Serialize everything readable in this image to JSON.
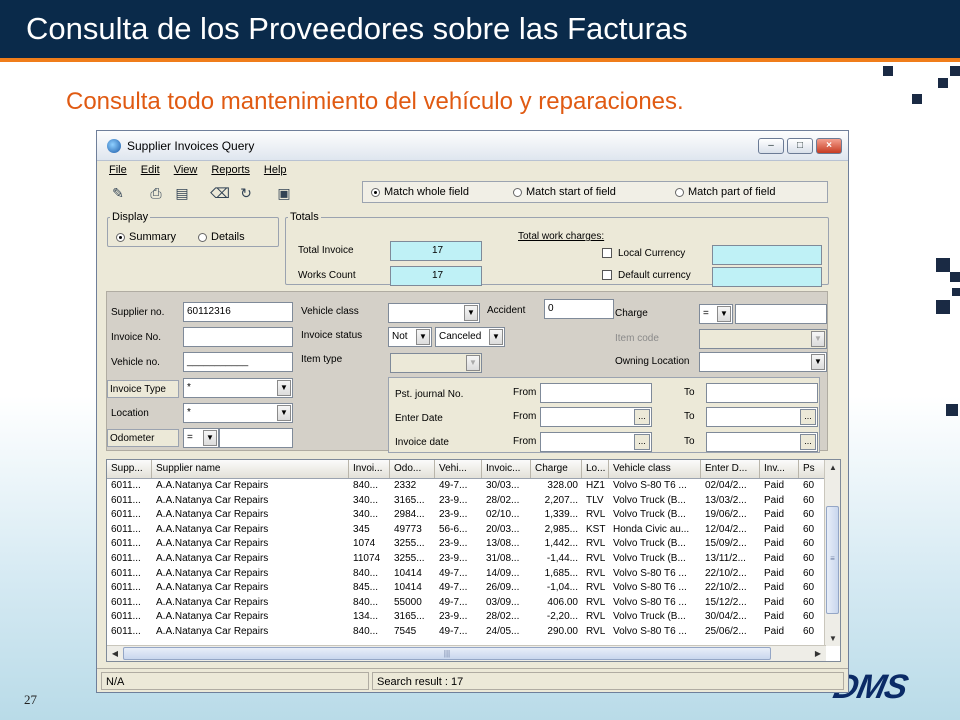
{
  "slide": {
    "title": "Consulta de los Proveedores sobre las Facturas",
    "subtitle": "Consulta todo mantenimiento del vehículo y reparaciones.",
    "page_number": "27",
    "brand": "DMS"
  },
  "window": {
    "title": "Supplier Invoices Query",
    "minimize": "–",
    "maximize": "□",
    "close": "×"
  },
  "menu": [
    "File",
    "Edit",
    "View",
    "Reports",
    "Help"
  ],
  "match": {
    "whole": "Match whole field",
    "start": "Match start of field",
    "part": "Match part of field",
    "selected": "whole"
  },
  "display": {
    "legend": "Display",
    "summary": "Summary",
    "details": "Details",
    "selected": "summary"
  },
  "totals": {
    "legend": "Totals",
    "total_invoice_label": "Total Invoice",
    "total_invoice": "17",
    "works_count_label": "Works Count",
    "works_count": "17",
    "work_charges_label": "Total work charges:",
    "local_currency": "Local Currency",
    "default_currency": "Default currency"
  },
  "filters": {
    "supplier_no_label": "Supplier no.",
    "supplier_no": "60112316",
    "invoice_no_label": "Invoice No.",
    "vehicle_no_label": "Vehicle no.",
    "vehicle_no": "___________",
    "invoice_type_label": "Invoice Type",
    "invoice_type": "*",
    "location_label": "Location",
    "location": "*",
    "odometer_label": "Odometer",
    "odometer_op": "=",
    "vehicle_class_label": "Vehicle class",
    "invoice_status_label": "Invoice status",
    "invoice_status_op": "Not",
    "invoice_status_value": "Canceled",
    "item_type_label": "Item type",
    "accident_label": "Accident",
    "accident": "0",
    "charge_label": "Charge",
    "charge_op": "=",
    "item_code_label": "Item code",
    "owning_location_label": "Owning Location",
    "pst_journal_label": "Pst. journal No.",
    "enter_date_label": "Enter Date",
    "invoice_date_label": "Invoice date",
    "from_label": "From",
    "to_label": "To",
    "ellipsis": "..."
  },
  "grid": {
    "columns": [
      "Supp...",
      "Supplier name",
      "Invoi...",
      "Odo...",
      "Vehi...",
      "Invoic...",
      "Charge",
      "Lo...",
      "Vehicle class",
      "Enter D...",
      "Inv...",
      "Ps"
    ],
    "rows": [
      [
        "6011...",
        "A.A.Natanya  Car Repairs",
        "840...",
        "2332",
        "49-7...",
        "30/03...",
        "328.00",
        "HZ1",
        "Volvo S-80 T6 ...",
        "02/04/2...",
        "Paid",
        "60"
      ],
      [
        "6011...",
        "A.A.Natanya  Car Repairs",
        "340...",
        "3165...",
        "23-9...",
        "28/02...",
        "2,207...",
        "TLV",
        "Volvo Truck (B...",
        "13/03/2...",
        "Paid",
        "60"
      ],
      [
        "6011...",
        "A.A.Natanya  Car Repairs",
        "340...",
        "2984...",
        "23-9...",
        "02/10...",
        "1,339...",
        "RVL",
        "Volvo Truck (B...",
        "19/06/2...",
        "Paid",
        "60"
      ],
      [
        "6011...",
        "A.A.Natanya  Car Repairs",
        "345",
        "49773",
        "56-6...",
        "20/03...",
        "2,985...",
        "KST",
        "Honda Civic au...",
        "12/04/2...",
        "Paid",
        "60"
      ],
      [
        "6011...",
        "A.A.Natanya  Car Repairs",
        "1074",
        "3255...",
        "23-9...",
        "13/08...",
        "1,442...",
        "RVL",
        "Volvo Truck (B...",
        "15/09/2...",
        "Paid",
        "60"
      ],
      [
        "6011...",
        "A.A.Natanya  Car Repairs",
        "11074",
        "3255...",
        "23-9...",
        "31/08...",
        "-1,44...",
        "RVL",
        "Volvo Truck (B...",
        "13/11/2...",
        "Paid",
        "60"
      ],
      [
        "6011...",
        "A.A.Natanya  Car Repairs",
        "840...",
        "10414",
        "49-7...",
        "14/09...",
        "1,685...",
        "RVL",
        "Volvo S-80 T6 ...",
        "22/10/2...",
        "Paid",
        "60"
      ],
      [
        "6011...",
        "A.A.Natanya  Car Repairs",
        "845...",
        "10414",
        "49-7...",
        "26/09...",
        "-1,04...",
        "RVL",
        "Volvo S-80 T6 ...",
        "22/10/2...",
        "Paid",
        "60"
      ],
      [
        "6011...",
        "A.A.Natanya  Car Repairs",
        "840...",
        "55000",
        "49-7...",
        "03/09...",
        "406.00",
        "RVL",
        "Volvo S-80 T6 ...",
        "15/12/2...",
        "Paid",
        "60"
      ],
      [
        "6011...",
        "A.A.Natanya  Car Repairs",
        "134...",
        "3165...",
        "23-9...",
        "28/02...",
        "-2,20...",
        "RVL",
        "Volvo Truck (B...",
        "30/04/2...",
        "Paid",
        "60"
      ],
      [
        "6011...",
        "A.A.Natanya  Car Repairs",
        "840...",
        "7545",
        "49-7...",
        "24/05...",
        "290.00",
        "RVL",
        "Volvo S-80 T6 ...",
        "25/06/2...",
        "Paid",
        "60"
      ]
    ]
  },
  "status": {
    "left": "N/A",
    "result": "Search result : 17"
  }
}
